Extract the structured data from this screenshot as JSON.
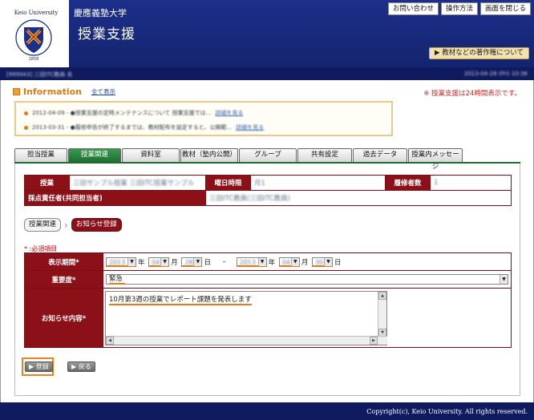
{
  "header": {
    "logo_text": "Keio University",
    "crest_year": "1858",
    "university": "慶應義塾大学",
    "system_name": "授業支援",
    "top_links": [
      "お問い合わせ",
      "操作方法",
      "画面を閉じる"
    ],
    "copyright_button": "▶ 教材などの著作権について"
  },
  "userbar": {
    "left": "[999943] 三田ITC教員 名",
    "right": "2013-04-28 (Fri) 10:36"
  },
  "info": {
    "title": "Information",
    "show_all": "全て表示",
    "notice": "※ 授業支援は24時間表示です。",
    "items": [
      {
        "text": "2012-04-09 - ●授業支援の定時メンテナンスについて    授業支援では...",
        "link": "詳細を見る"
      },
      {
        "text": "2013-03-31 - ●履修申告が終了するまでは、教材配布を設定すると、公開範...",
        "link": "詳細を見る"
      }
    ]
  },
  "tabs": [
    {
      "label": "担当授業",
      "active": false
    },
    {
      "label": "授業関連",
      "active": true
    },
    {
      "label": "資料室",
      "active": false
    },
    {
      "label": "教材（塾内公開）",
      "active": false
    },
    {
      "label": "グループ",
      "active": false
    },
    {
      "label": "共有設定",
      "active": false
    },
    {
      "label": "過去データ",
      "active": false
    },
    {
      "label": "授業内メッセージ",
      "active": false
    }
  ],
  "course": {
    "course_label": "授業",
    "course_value": "三田サンプル授業 三田ITC授業サンプル",
    "day_label": "曜日時限",
    "day_value": "月1",
    "enroll_label": "履修者数",
    "enroll_value": "1",
    "grader_label": "採点責任者(共同担当者)",
    "grader_value": "三田ITC教員(三田ITC教員)"
  },
  "breadcrumb": {
    "parent": "授業関連",
    "current": "お知らせ登録"
  },
  "form": {
    "required_note": "* :必須項目",
    "period_label": "表示期間*",
    "start_year": "2013",
    "start_month": "04",
    "start_day": "28",
    "end_year": "2013",
    "end_month": "04",
    "end_day": "30",
    "unit_year": "年",
    "unit_month": "月",
    "unit_day": "日",
    "range_sep": "–",
    "priority_label": "重要度*",
    "priority_value": "緊急",
    "content_label": "お知らせ内容*",
    "content_value": "10月第3週の授業でレポート課題を発表します"
  },
  "buttons": {
    "register": "▶ 登録",
    "back": "▶ 戻る"
  },
  "footer": {
    "copyright": "Copyright(c), Keio University. All rights reserved."
  },
  "colors": {
    "header_bg": "#1c2f8a",
    "label_bg": "#8b1018",
    "active_tab": "#1f6d33",
    "highlight": "#e87a10"
  }
}
